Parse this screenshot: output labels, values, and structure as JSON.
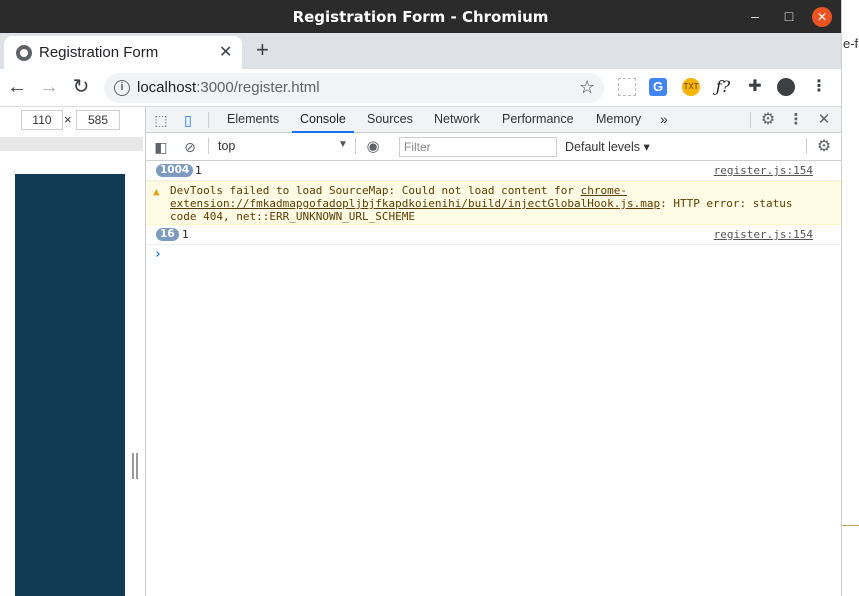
{
  "window": {
    "title": "Registration Form - Chromium"
  },
  "other_window": {
    "fragment": "e-fi"
  },
  "tab": {
    "label": "Registration Form"
  },
  "omnibox": {
    "host": "localhost",
    "path": ":3000/register.html"
  },
  "device": {
    "width": "110",
    "height": "585",
    "times": "×"
  },
  "devtools": {
    "tabs": [
      "Elements",
      "Console",
      "Sources",
      "Network",
      "Performance",
      "Memory"
    ],
    "active_tab": "Console",
    "more": "»"
  },
  "console": {
    "context": "top",
    "filter_placeholder": "Filter",
    "levels": "Default levels ▾",
    "messages": [
      {
        "count": "1004",
        "text": "1",
        "source": "register.js:154"
      },
      {
        "warning": true,
        "text_prefix": "DevTools failed to load SourceMap: Could not load content for ",
        "link": "chrome-extension://fmkadmapgofadopljbjfkapdkoienihi/build/injectGlobalHook.js.map",
        "text_suffix": ": HTTP error: status code 404, net::ERR_UNKNOWN_URL_SCHEME"
      },
      {
        "count": "16",
        "text": "1",
        "source": "register.js:154"
      }
    ],
    "prompt": "›"
  },
  "colors": {
    "accent": "#1a73e8",
    "page_bg": "#113a55",
    "close": "#e95420"
  }
}
